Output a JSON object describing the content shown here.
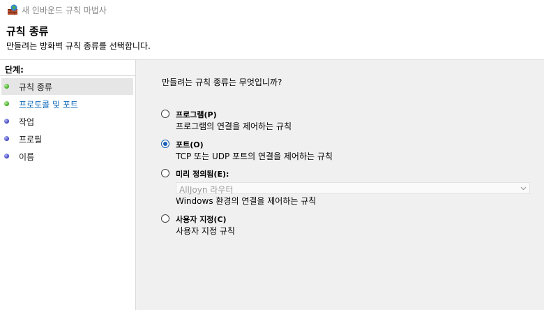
{
  "window": {
    "title": "새 인바운드 규칙 마법사"
  },
  "header": {
    "title": "규칙 종류",
    "subtitle": "만들려는 방화벽 규칙 종류를 선택합니다."
  },
  "steps": {
    "label": "단계:",
    "items": [
      {
        "label": "규칙 종류",
        "bullet": "green",
        "active": true
      },
      {
        "label": "프로토콜 및 포트",
        "bullet": "green",
        "link": true
      },
      {
        "label": "작업",
        "bullet": "blue"
      },
      {
        "label": "프로필",
        "bullet": "blue"
      },
      {
        "label": "이름",
        "bullet": "blue"
      }
    ]
  },
  "main": {
    "question": "만들려는 규칙 종류는 무엇입니까?",
    "options": [
      {
        "label": "프로그램(P)",
        "description": "프로그램의 연결을 제어하는 규칙",
        "checked": false
      },
      {
        "label": "포트(O)",
        "description": "TCP 또는 UDP 포트의 연결을 제어하는 규칙",
        "checked": true
      },
      {
        "label": "미리 정의됨(E):",
        "description": "Windows 환경의 연결을 제어하는 규칙",
        "checked": false,
        "select_value": "AllJoyn 라우터"
      },
      {
        "label": "사용자 지정(C)",
        "description": "사용자 지정 규칙",
        "checked": false
      }
    ]
  },
  "colors": {
    "link": "#0a66b7",
    "radio_checked": "#1a5fb4",
    "bullet_green": "#3aa51a",
    "bullet_blue": "#3a3fb5"
  }
}
